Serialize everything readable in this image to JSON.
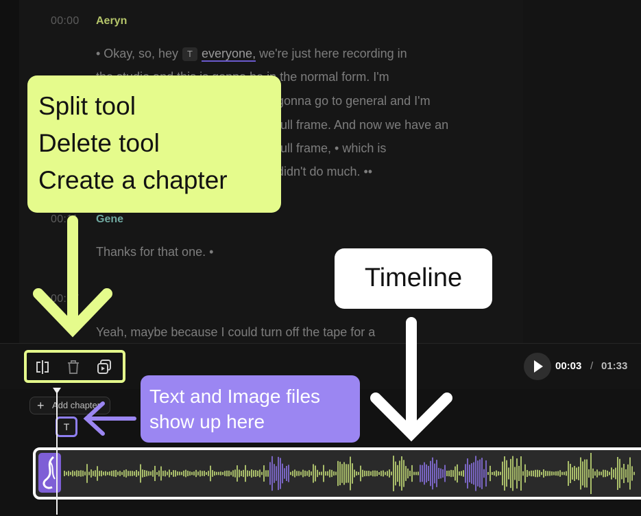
{
  "transcript": {
    "blocks": [
      {
        "time": "00:00",
        "speaker": "Aeryn",
        "speaker_color": "#b5c56a",
        "first_line": {
          "pre": "• Okay, so, hey",
          "chip": "T",
          "highlight": "everyone,",
          "post": "we're just here recording in"
        },
        "lines": [
          "the studio and this is gonna be in the normal form. I'm",
          "gonna go to general and I'm",
          "full frame. And now we have an",
          "full frame, • which is",
          "didn't do much. ••"
        ]
      },
      {
        "time": "00:11",
        "speaker": "Gene",
        "speaker_color": "#6fa8a0",
        "lines": [
          "Thanks for that one. •"
        ]
      },
      {
        "time": "00:17",
        "speaker": "",
        "lines": [
          "Yeah, maybe because I could turn off the tape for a"
        ]
      }
    ]
  },
  "toolbar": {
    "tools": [
      {
        "name": "split-tool",
        "icon": "split-icon"
      },
      {
        "name": "delete-tool",
        "icon": "trash-icon"
      },
      {
        "name": "create-chapter-tool",
        "icon": "chapter-icon"
      }
    ],
    "play_icon": "play-icon",
    "current_time": "00:03",
    "separator": "/",
    "total_time": "01:33"
  },
  "track": {
    "add_chapter_label": "Add chapter",
    "text_file_chip": "T"
  },
  "waveform": {
    "accent_colors": {
      "clip": "#7e5fd6",
      "wave_green": "#c9e27a",
      "wave_purple": "#8d74e8"
    }
  },
  "annotations": {
    "tools_callout": [
      "Split tool",
      "Delete tool",
      "Create a chapter"
    ],
    "tools_callout_color": "#e5fb8c",
    "timeline_callout": "Timeline",
    "files_callout": [
      "Text and Image files",
      "show up here"
    ],
    "files_callout_color": "#9b86f2"
  }
}
